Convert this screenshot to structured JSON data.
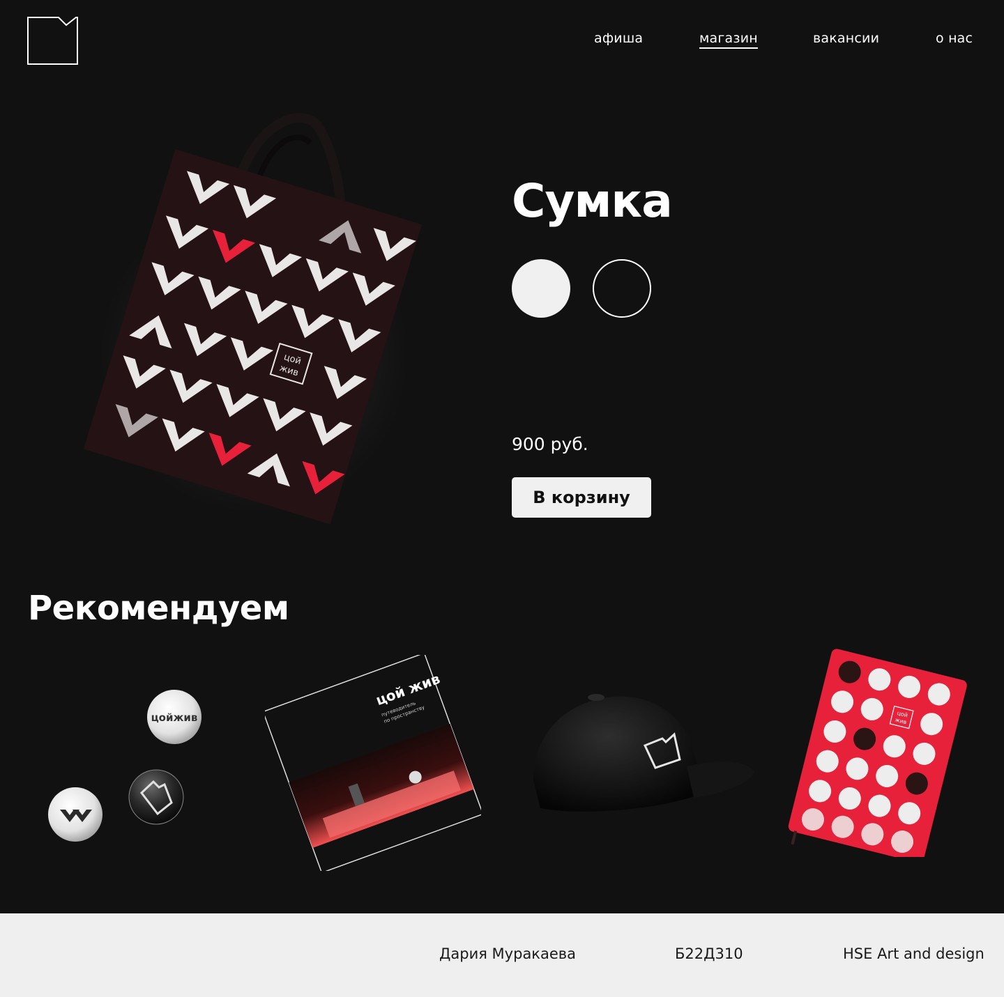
{
  "nav": {
    "items": [
      "афиша",
      "магазин",
      "вакансии",
      "о нас"
    ],
    "active": "магазин"
  },
  "product": {
    "title": "Сумка",
    "colors": [
      "#f0f0f0",
      "#111111"
    ],
    "price": "900 руб.",
    "cart_label": "В корзину",
    "bag_label_top": "цой",
    "bag_label_bottom": "жив"
  },
  "recommended": {
    "heading": "Рекомендуем",
    "pin_text": "цойжив",
    "book_title": "цой жив",
    "book_subtitle_1": "путеводитель",
    "book_subtitle_2": "по пространству",
    "notebook_label_top": "цой",
    "notebook_label_bottom": "жив"
  },
  "footer": {
    "author": "Дария Муракаева",
    "group": "Б22Д310",
    "school": "HSE Art and design"
  },
  "colors": {
    "background": "#111111",
    "accent_red": "#e8213a",
    "footer_bg": "#efefef"
  }
}
